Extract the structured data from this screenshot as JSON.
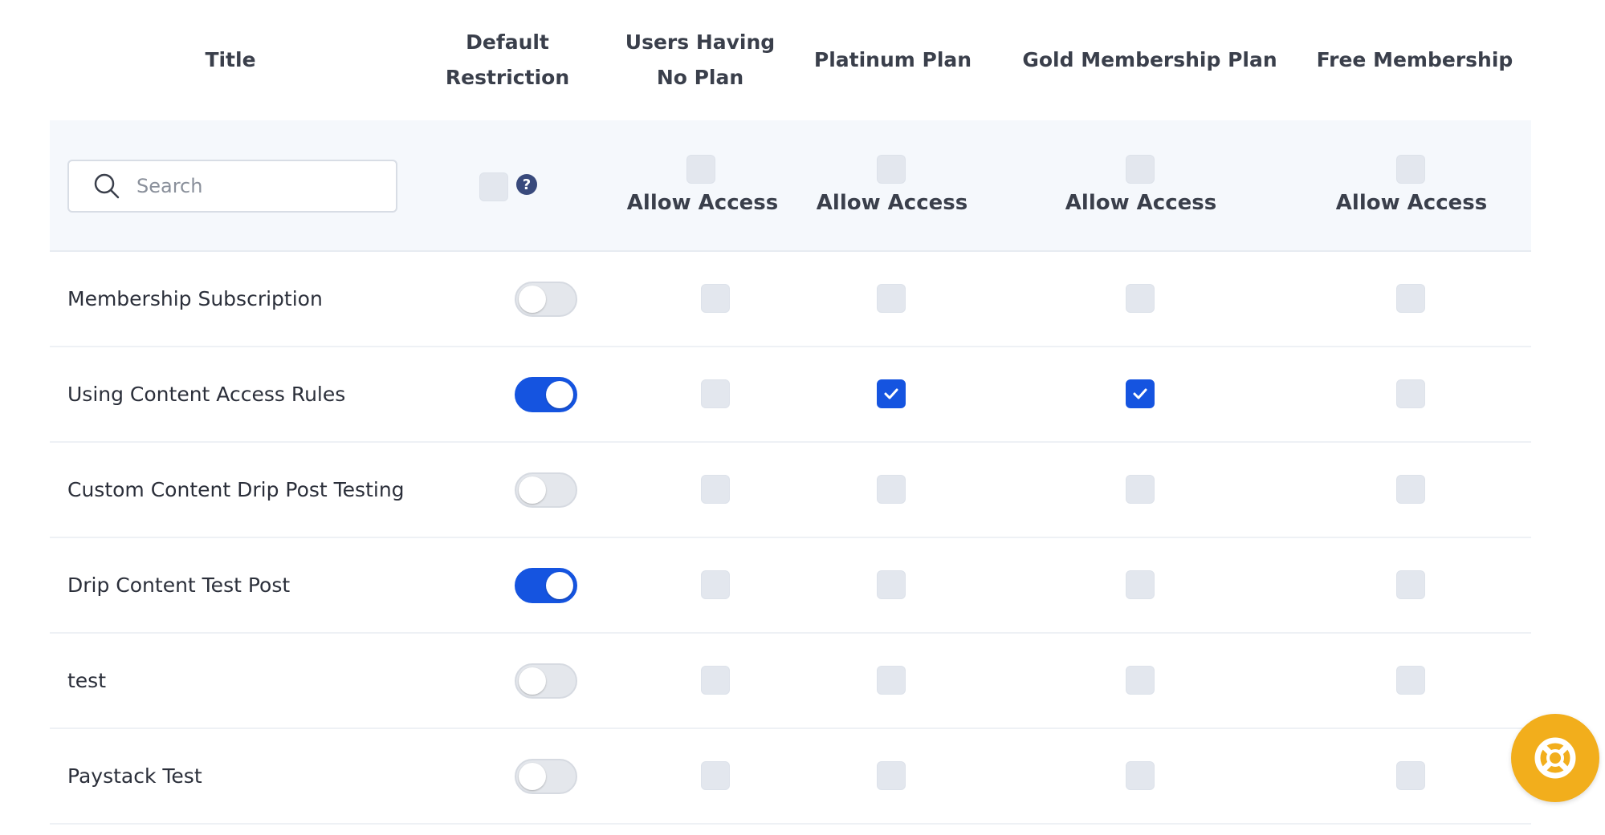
{
  "columns": {
    "title": "Title",
    "default_restriction": [
      "Default",
      "Restriction"
    ],
    "users_no_plan": [
      "Users Having",
      "No Plan"
    ],
    "platinum": "Platinum Plan",
    "gold": "Gold Membership Plan",
    "free": "Free Membership"
  },
  "filter": {
    "search_placeholder": "Search",
    "allow_access_label": "Allow Access",
    "help_glyph": "?"
  },
  "rows": [
    {
      "title": "Membership Subscription",
      "default_restriction": false,
      "users_no_plan": false,
      "platinum": false,
      "gold": false,
      "free": false
    },
    {
      "title": "Using Content Access Rules",
      "default_restriction": true,
      "users_no_plan": false,
      "platinum": true,
      "gold": true,
      "free": false
    },
    {
      "title": "Custom Content Drip Post Testing",
      "default_restriction": false,
      "users_no_plan": false,
      "platinum": false,
      "gold": false,
      "free": false
    },
    {
      "title": "Drip Content Test Post",
      "default_restriction": true,
      "users_no_plan": false,
      "platinum": false,
      "gold": false,
      "free": false
    },
    {
      "title": "test",
      "default_restriction": false,
      "users_no_plan": false,
      "platinum": false,
      "gold": false,
      "free": false
    },
    {
      "title": "Paystack Test",
      "default_restriction": false,
      "users_no_plan": false,
      "platinum": false,
      "gold": false,
      "free": false
    }
  ],
  "colors": {
    "accent": "#1554e0",
    "fab": "#f2ae1c"
  },
  "icons": {
    "search": "search-icon",
    "help": "question-circle-icon",
    "fab": "lifebuoy-icon"
  }
}
